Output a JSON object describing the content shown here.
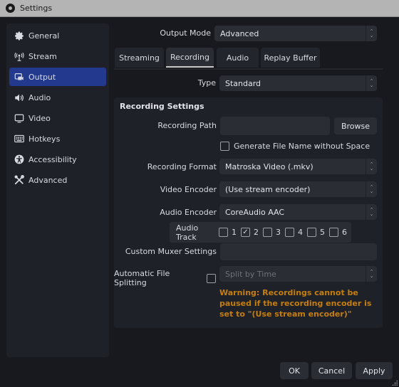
{
  "window": {
    "title": "Settings",
    "icon": "obs-logo-icon"
  },
  "sidebar": {
    "items": [
      {
        "label": "General",
        "icon": "gear-icon",
        "active": false
      },
      {
        "label": "Stream",
        "icon": "antenna-icon",
        "active": false
      },
      {
        "label": "Output",
        "icon": "output-icon",
        "active": true
      },
      {
        "label": "Audio",
        "icon": "speaker-icon",
        "active": false
      },
      {
        "label": "Video",
        "icon": "monitor-icon",
        "active": false
      },
      {
        "label": "Hotkeys",
        "icon": "keyboard-icon",
        "active": false
      },
      {
        "label": "Accessibility",
        "icon": "accessibility-icon",
        "active": false
      },
      {
        "label": "Advanced",
        "icon": "tools-icon",
        "active": false
      }
    ]
  },
  "output_mode": {
    "label": "Output Mode",
    "value": "Advanced"
  },
  "tabs": [
    {
      "label": "Streaming",
      "active": false
    },
    {
      "label": "Recording",
      "active": true
    },
    {
      "label": "Audio",
      "active": false
    },
    {
      "label": "Replay Buffer",
      "active": false
    }
  ],
  "type": {
    "label": "Type",
    "value": "Standard"
  },
  "recording_settings": {
    "title": "Recording Settings",
    "recording_path": {
      "label": "Recording Path",
      "value": "",
      "browse_label": "Browse"
    },
    "generate_filename": {
      "label": "Generate File Name without Space",
      "checked": false
    },
    "recording_format": {
      "label": "Recording Format",
      "value": "Matroska Video (.mkv)"
    },
    "video_encoder": {
      "label": "Video Encoder",
      "value": "(Use stream encoder)"
    },
    "audio_encoder": {
      "label": "Audio Encoder",
      "value": "CoreAudio AAC"
    },
    "audio_track": {
      "label": "Audio Track",
      "tracks": [
        {
          "num": "1",
          "checked": false
        },
        {
          "num": "2",
          "checked": true
        },
        {
          "num": "3",
          "checked": false
        },
        {
          "num": "4",
          "checked": false
        },
        {
          "num": "5",
          "checked": false
        },
        {
          "num": "6",
          "checked": false
        }
      ]
    },
    "custom_muxer": {
      "label": "Custom Muxer Settings",
      "value": ""
    },
    "auto_split": {
      "label": "Automatic File Splitting",
      "checked": false,
      "mode": "Split by Time"
    },
    "warning": "Warning: Recordings cannot be paused if the recording encoder is set to \"(Use stream encoder)\""
  },
  "footer": {
    "ok": "OK",
    "cancel": "Cancel",
    "apply": "Apply"
  },
  "colors": {
    "accent": "#22398e",
    "warning": "#c57e0e",
    "background": "#18191e",
    "panel": "#1f2129",
    "control": "#2b2d35"
  }
}
